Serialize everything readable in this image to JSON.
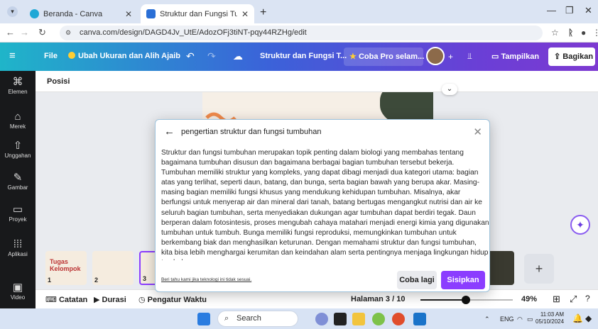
{
  "browser": {
    "tabs": [
      {
        "title": "Beranda - Canva",
        "active": false,
        "favicon_color": "#1fa8d6"
      },
      {
        "title": "Struktur dan Fungsi Tumbuhan",
        "active": true,
        "favicon_color": "#2a6fd6"
      }
    ],
    "url": "canva.com/design/DAGD4Jv_UtE/AdozOFj3tiNT-pqy44RZHg/edit"
  },
  "toolbar": {
    "file": "File",
    "resize": "Ubah Ukuran dan Alih Ajaib",
    "doc_title": "Struktur dan Fungsi T...",
    "pro": "Coba Pro selam...",
    "present": "Tampilkan",
    "share": "Bagikan"
  },
  "rail": [
    {
      "label": "Elemen",
      "icon": "elements-icon"
    },
    {
      "label": "Merek",
      "icon": "brand-icon"
    },
    {
      "label": "Unggahan",
      "icon": "upload-icon"
    },
    {
      "label": "Gambar",
      "icon": "draw-icon"
    },
    {
      "label": "Proyek",
      "icon": "folder-icon"
    },
    {
      "label": "Aplikasi",
      "icon": "apps-icon"
    },
    {
      "label": "Video",
      "icon": "video-icon"
    }
  ],
  "editor": {
    "position_label": "Posisi",
    "thumbnails": [
      {
        "number": "1",
        "title": "Tugas Kelompok"
      },
      {
        "number": "2",
        "title": ""
      },
      {
        "number": "3",
        "title": ""
      }
    ]
  },
  "modal": {
    "query": "pengertian struktur dan fungsi tumbuhan",
    "body": "Struktur dan fungsi tumbuhan merupakan topik penting dalam biologi yang membahas tentang bagaimana tumbuhan disusun dan bagaimana berbagai bagian tumbuhan tersebut bekerja. Tumbuhan memiliki struktur yang kompleks, yang dapat dibagi menjadi dua kategori utama: bagian atas yang terlihat, seperti daun, batang, dan bunga, serta bagian bawah yang berupa akar. Masing-masing bagian memiliki fungsi khusus yang mendukung kehidupan tumbuhan. Misalnya, akar berfungsi untuk menyerap air dan mineral dari tanah, batang bertugas mengangkut nutrisi dan air ke seluruh bagian tumbuhan, serta menyediakan dukungan agar tumbuhan dapat berdiri tegak. Daun berperan dalam fotosintesis, proses mengubah cahaya matahari menjadi energi kimia yang digunakan tumbuhan untuk tumbuh. Bunga memiliki fungsi reproduksi, memungkinkan tumbuhan untuk berkembang biak dan menghasilkan keturunan. Dengan memahami struktur dan fungsi tumbuhan, kita bisa lebih menghargai kerumitan dan keindahan alam serta pentingnya menjaga lingkungan hidup tumbuhan.",
    "feedback_link": "Beri tahu kami jika teknologi ini tidak sesuai.",
    "retry": "Coba lagi",
    "insert": "Sisipkan"
  },
  "bottom": {
    "notes": "Catatan",
    "duration": "Durasi",
    "timer": "Pengatur Waktu",
    "page": "Halaman 3 / 10",
    "zoom": "49%",
    "zoom_fraction": 0.49
  },
  "taskbar": {
    "search": "Search",
    "lang": "ENG",
    "time": "11:03 AM",
    "date": "05/10/2024"
  },
  "colors": {
    "canva_gradient_start": "#1fb5c9",
    "canva_gradient_end": "#7d3ad1",
    "insert_button": "#8b3dff"
  }
}
